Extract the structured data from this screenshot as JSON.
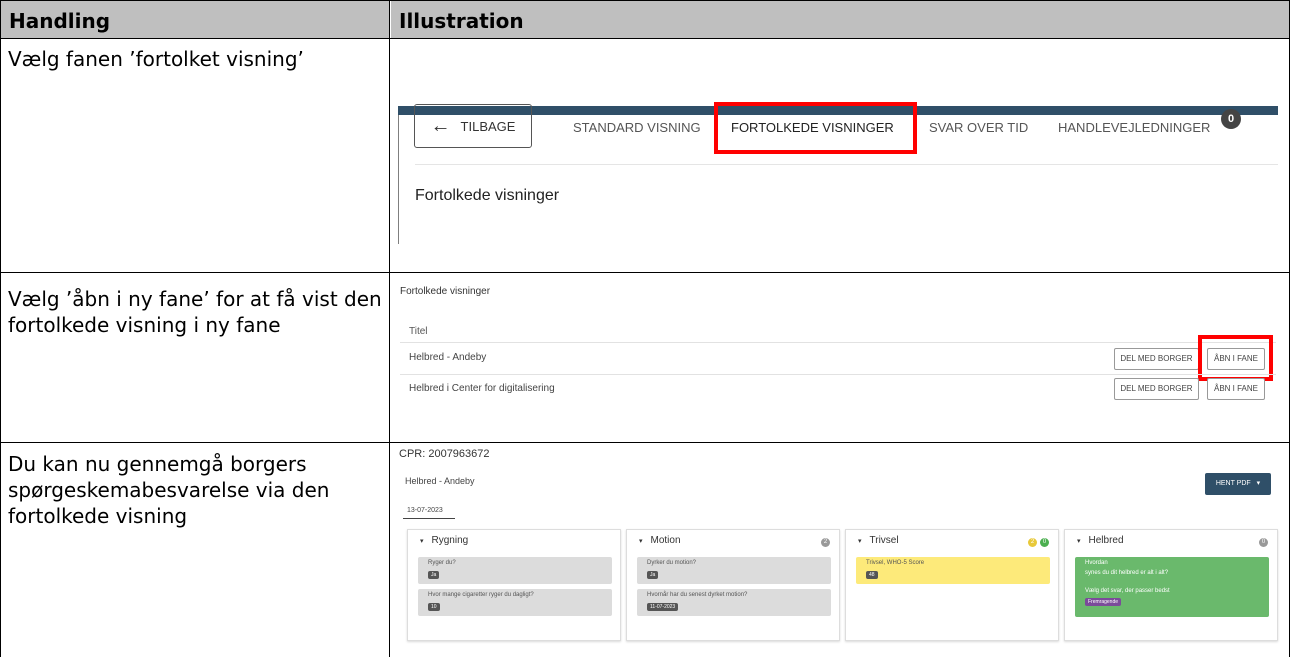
{
  "table": {
    "headers": [
      "Handling",
      "Illustration"
    ],
    "rows": [
      {
        "action": "Vælg fanen ’fortolket visning’"
      },
      {
        "action": "Vælg ’åbn i ny fane’ for at få vist den fortolkede visning i ny fane"
      },
      {
        "action": "Du kan nu gennemgå borgers spørgeskemabesvarelse via den fortolkede visning"
      }
    ]
  },
  "ill1": {
    "back_label": "TILBAGE",
    "tabs": [
      "STANDARD VISNING",
      "FORTOLKEDE VISNINGER",
      "SVAR OVER TID",
      "HANDLEVEJLEDNINGER"
    ],
    "badge": "0",
    "title": "Fortolkede visninger",
    "colors": {
      "topbar": "#2f4f68",
      "highlight": "#ff0000"
    }
  },
  "ill2": {
    "heading": "Fortolkede visninger",
    "column": "Titel",
    "rows": [
      {
        "title": "Helbred - Andeby",
        "share": "DEL MED BORGER",
        "open": "ÅBN I FANE"
      },
      {
        "title": "Helbred i Center for digitalisering",
        "share": "DEL MED BORGER",
        "open": "ÅBN I FANE"
      }
    ]
  },
  "ill3": {
    "cpr": "CPR: 2007963672",
    "subtitle": "Helbred - Andeby",
    "pdf_button": "HENT PDF",
    "date": "13-07-2023",
    "cards": [
      {
        "title": "Rygning",
        "items": [
          {
            "q": "Ryger du?",
            "a": "Ja"
          },
          {
            "q": "Hvor mange cigaretter ryger du dagligt?",
            "a": "10"
          }
        ]
      },
      {
        "title": "Motion",
        "count": "2",
        "items": [
          {
            "q": "Dyrker du motion?",
            "a": "Ja"
          },
          {
            "q": "Hvornår har du senest dyrket motion?",
            "a": "11-07-2023"
          }
        ]
      },
      {
        "title": "Trivsel",
        "counts": [
          "2",
          "0"
        ],
        "items": [
          {
            "q": "Trivsel, WHO-5 Score",
            "a": "48"
          }
        ]
      },
      {
        "title": "Helbred",
        "count": "0",
        "items": [
          {
            "q": "Hvordan",
            "q2": "synes du dit helbred er alt i alt?"
          },
          {
            "q": "Vælg det svar, der passer bedst",
            "a": "Fremragende"
          }
        ]
      }
    ],
    "colors": {
      "yellow": "#fdea7a",
      "green": "#6ab96c",
      "grey": "#dcdcdc",
      "dark": "#2f4f68"
    }
  }
}
